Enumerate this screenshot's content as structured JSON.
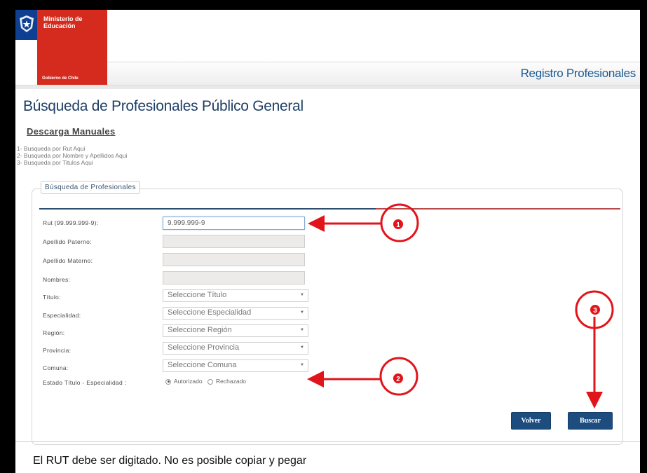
{
  "header": {
    "ministry_name": "Ministerio de Educación",
    "government": "Gobierno de Chile",
    "site_title": "Registro Profesionales"
  },
  "page": {
    "title": "Búsqueda de Profesionales Público General",
    "downloads_title": "Descarga Manuales",
    "search_links": [
      "1- Busqueda por Rut Aqui",
      "2- Busqueda por Nombre y Apellidos Aqui",
      "3- Busqueda por Titulos Aqui"
    ]
  },
  "form": {
    "legend": "Búsqueda de Profesionales",
    "rut": {
      "label": "Rut (99.999.999-9):",
      "value": "9.999.999-9"
    },
    "apellido_paterno": {
      "label": "Apellido Paterno:",
      "value": ""
    },
    "apellido_materno": {
      "label": "Apellido Materno:",
      "value": ""
    },
    "nombres": {
      "label": "Nombres:",
      "value": ""
    },
    "titulo": {
      "label": "Título:",
      "selected": "Seleccione Título"
    },
    "especialidad": {
      "label": "Especialidad:",
      "selected": "Seleccione Especialidad"
    },
    "region": {
      "label": "Región:",
      "selected": "Seleccione Región"
    },
    "provincia": {
      "label": "Provincia:",
      "selected": "Seleccione Provincia"
    },
    "comuna": {
      "label": "Comuna:",
      "selected": "Seleccione Comuna"
    },
    "estado": {
      "label": "Estado Título - Especialidad :",
      "option_authorized": "Autorizado",
      "option_rejected": "Rechazado",
      "selected": "Autorizado"
    },
    "back_button": "Volver",
    "search_button": "Buscar"
  },
  "annotations": {
    "marker_1": "1",
    "marker_2": "2",
    "marker_3": "3",
    "color": "#e1141b"
  },
  "footer_note": "El RUT debe ser digitado. No es posible copiar y pegar",
  "colors": {
    "brand_red": "#d52b1e",
    "brand_blue": "#0e3f91",
    "title_blue": "#1d5a92",
    "button_blue": "#1d4d7f"
  }
}
